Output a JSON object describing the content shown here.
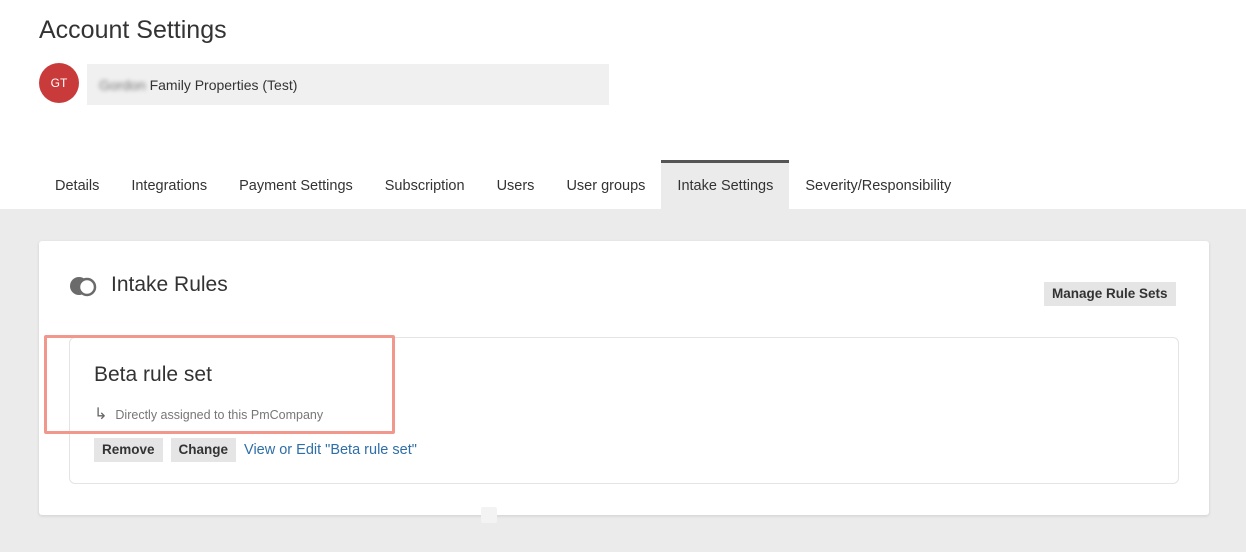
{
  "header": {
    "title": "Account Settings",
    "avatar_initials": "GT",
    "account": {
      "name_obscured": "Gordon",
      "name_rest": " Family Properties (Test)"
    }
  },
  "tabs": [
    {
      "label": "Details"
    },
    {
      "label": "Integrations"
    },
    {
      "label": "Payment Settings"
    },
    {
      "label": "Subscription"
    },
    {
      "label": "Users"
    },
    {
      "label": "User groups"
    },
    {
      "label": "Intake Settings",
      "active": true
    },
    {
      "label": "Severity/Responsibility"
    }
  ],
  "card": {
    "title": "Intake Rules",
    "manage_label": "Manage Rule Sets",
    "rule": {
      "name": "Beta rule set",
      "assignment": "Directly assigned to this PmCompany",
      "remove_label": "Remove",
      "change_label": "Change",
      "edit_link": "View or Edit \"Beta rule set\""
    }
  },
  "colors": {
    "avatar": "#c93a3a",
    "link": "#2f6ea6",
    "highlight": "#f2978b"
  }
}
